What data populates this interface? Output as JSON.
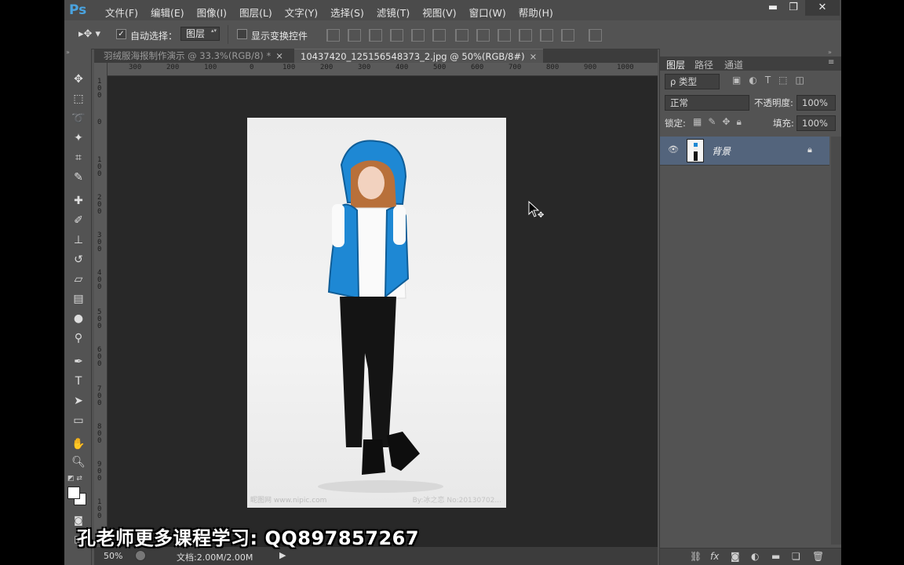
{
  "app": {
    "logo": "Ps"
  },
  "menu": [
    "文件(F)",
    "编辑(E)",
    "图像(I)",
    "图层(L)",
    "文字(Y)",
    "选择(S)",
    "滤镜(T)",
    "视图(V)",
    "窗口(W)",
    "帮助(H)"
  ],
  "window_controls": {
    "minimize": "▬",
    "restore": "❐",
    "close": "✕"
  },
  "options": {
    "auto_select_label": "自动选择：",
    "auto_select_checked": true,
    "auto_select_target": "图层",
    "show_transform_label": "显示变换控件",
    "show_transform_checked": false
  },
  "tabs": [
    {
      "label": "羽绒服海报制作演示 @ 33.3%(RGB/8) *",
      "active": false,
      "close": "×"
    },
    {
      "label": "10437420_125156548373_2.jpg @ 50%(RGB/8#)",
      "active": true,
      "close": "×"
    }
  ],
  "ruler_top": [
    "300",
    "200",
    "100",
    "0",
    "100",
    "200",
    "300",
    "400",
    "500",
    "600",
    "700",
    "800",
    "900",
    "1000"
  ],
  "ruler_left": [
    "100",
    "0",
    "100",
    "200",
    "300",
    "400",
    "500",
    "600",
    "700",
    "800",
    "900",
    "100"
  ],
  "photo": {
    "watermark_left": "昵图网 www.nipic.com",
    "watermark_right": "By:冰之恋 No:20130702...",
    "hood_color": "#1e88d4",
    "pants_color": "#141414",
    "hair_color": "#b8703a"
  },
  "status": {
    "zoom": "50%",
    "doc": "文档:2.00M/2.00M"
  },
  "panel": {
    "tabs": [
      "图层",
      "路径",
      "通道"
    ],
    "filter_label": "ρ 类型",
    "blend_mode": "正常",
    "opacity_label": "不透明度:",
    "opacity_value": "100%",
    "lock_label": "锁定:",
    "fill_label": "填充:",
    "fill_value": "100%",
    "layer_name": "背景"
  },
  "overlay_caption": "孔老师更多课程学习:  QQ897857267",
  "colors": {
    "accent": "#4aa3df",
    "selected_layer": "#53647c"
  }
}
